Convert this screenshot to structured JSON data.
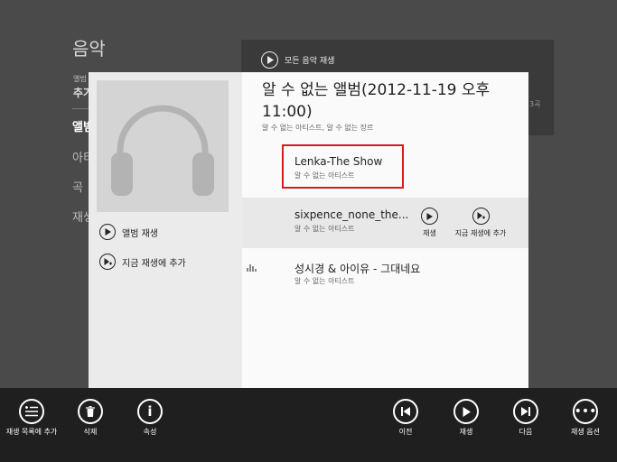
{
  "background": {
    "title": "음악",
    "small_label": "앨범",
    "add_label": "추가",
    "nav": [
      "앨범",
      "아티",
      "곡",
      "재생"
    ],
    "play_all": "모든 음악 재생",
    "count": "3곡"
  },
  "popup": {
    "album_title": "알 수 없는 앨범(2012-11-19 오후 11:00)",
    "album_meta": "알 수 없는 아티스트, 알 수 없는 장르",
    "play_album": "앨범 재생",
    "add_to_now_playing": "지금 재생에 추가",
    "tracks": [
      {
        "name": "Lenka-The Show",
        "artist": "알 수 없는 아티스트"
      },
      {
        "name": "sixpence_none_the...",
        "artist": "알 수 없는 아티스트"
      },
      {
        "name": "성시경 & 아이유 - 그대네요",
        "artist": "알 수 없는 아티스트"
      }
    ],
    "track_actions": {
      "play": "재생",
      "add": "지금 재생에 추가"
    }
  },
  "appbar": {
    "add_to_playlist": "재생 목록에 추가",
    "delete": "삭제",
    "properties": "속성",
    "previous": "이전",
    "play": "재생",
    "next": "다음",
    "play_options": "재생 옵션"
  },
  "colors": {
    "highlight": "#d71920",
    "appbar": "#1f1f1f"
  }
}
